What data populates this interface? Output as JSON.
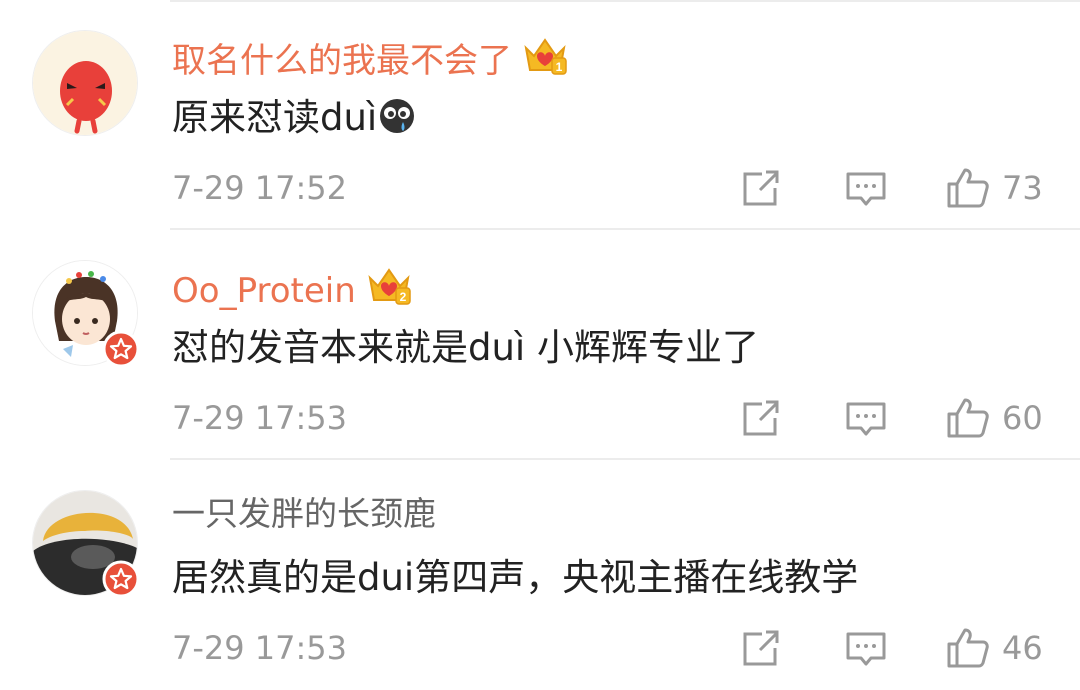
{
  "comments": [
    {
      "username": "取名什么的我最不会了",
      "username_style": "vip",
      "badge": "crown-badge-icon",
      "badge_level": "1",
      "avatar": "red-bean-avatar",
      "verified": false,
      "content": "原来怼读duì",
      "content_emoji": "crying-face-emoji-icon",
      "time": "7-29 17:52",
      "likes": "73"
    },
    {
      "username": "Oo_Protein",
      "username_style": "vip",
      "badge": "crown-badge-icon",
      "badge_level": "2",
      "avatar": "anime-girl-avatar",
      "verified": true,
      "content": "怼的发音本来就是duì 小辉辉专业了",
      "time": "7-29 17:53",
      "likes": "60"
    },
    {
      "username": "一只发胖的长颈鹿",
      "username_style": "plain",
      "avatar": "yellow-hat-avatar",
      "verified": true,
      "content": "居然真的是dui第四声，央视主播在线教学",
      "time": "7-29 17:53",
      "likes": "46"
    }
  ],
  "icons": {
    "repost": "repost-icon",
    "reply": "comment-icon",
    "like": "thumbs-up-icon",
    "verified": "verified-star-icon"
  },
  "colors": {
    "vip_name": "#eb7350",
    "plain_name": "#666666",
    "text": "#222222",
    "meta": "#999999",
    "verified_badge": "#e8503a",
    "crown": "#f5b923"
  }
}
